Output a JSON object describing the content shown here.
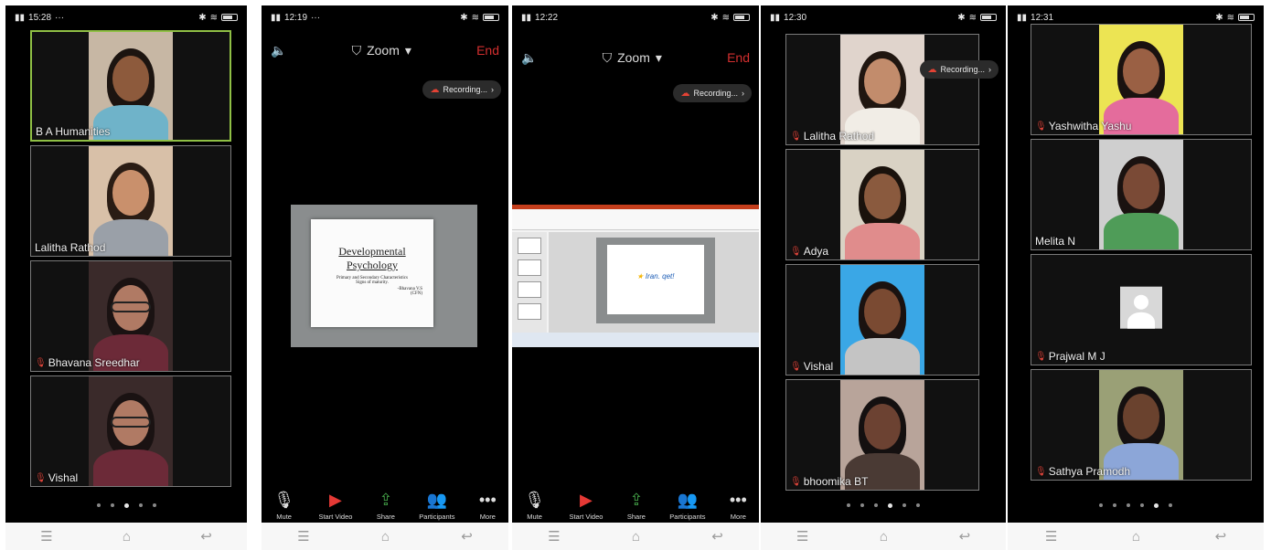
{
  "colors": {
    "active_border": "#8fbf45",
    "end_red": "#d32f2f",
    "mic_off": "#e0463c",
    "video_off": "#e53935",
    "share_green": "#43a047"
  },
  "screens": [
    {
      "status": {
        "time": "15:28",
        "extra": "···"
      },
      "tiles": [
        {
          "name": "B A Humanities",
          "muted": false,
          "bg": "#c7b7a4",
          "skin": "#8d5a3c",
          "hair": "#1c1410",
          "shirt": "#6fb3c9"
        },
        {
          "name": "Lalitha Rathod",
          "muted": false,
          "bg": "#d8c0a8",
          "skin": "#c9906c",
          "hair": "#2a1c14",
          "shirt": "#9aa0a8"
        },
        {
          "name": "Bhavana Sreedhar",
          "muted": true,
          "bg": "#3a2a2a",
          "skin": "#b07a64",
          "hair": "#1a1212",
          "shirt": "#6c2a38"
        },
        {
          "name": "Vishal",
          "muted": true,
          "bg": "#3a2a2a",
          "skin": "#b07a64",
          "hair": "#1a1212",
          "shirt": "#6c2a38"
        }
      ],
      "dots": 5,
      "active_dot": 2
    },
    {
      "status": {
        "time": "12:19",
        "extra": "···"
      },
      "top": {
        "title": "Zoom",
        "end": "End"
      },
      "recording": "Recording...",
      "slide": {
        "title_line1": "Developmental",
        "title_line2": "Psychology",
        "line1": "Primary and Secondary Characteristics",
        "line2": "Signs of maturity.",
        "author": "-Bhavana V.S",
        "author2": "(CFN)"
      },
      "toolbar": [
        "Mute",
        "Start Video",
        "Share",
        "Participants",
        "More"
      ]
    },
    {
      "status": {
        "time": "12:22",
        "extra": ""
      },
      "top": {
        "title": "Zoom",
        "end": "End"
      },
      "recording": "Recording...",
      "slide_caption": "Iran. qet!",
      "toolbar": [
        "Mute",
        "Start Video",
        "Share",
        "Participants",
        "More"
      ]
    },
    {
      "status": {
        "time": "12:30",
        "extra": ""
      },
      "recording": "Recording...",
      "tiles": [
        {
          "name": "Lalitha Rathod",
          "muted": true,
          "bg": "#e0d4cc",
          "skin": "#c28c6c",
          "hair": "#201610",
          "shirt": "#f1ede6"
        },
        {
          "name": "Adya",
          "muted": true,
          "bg": "#d9d2c4",
          "skin": "#8a5a3e",
          "hair": "#1a120c",
          "shirt": "#e08c8c"
        },
        {
          "name": "Vishal",
          "muted": true,
          "bg": "#3aa7e6",
          "skin": "#7a4a32",
          "hair": "#1a1210",
          "shirt": "#c4c4c4"
        },
        {
          "name": "bhoomika BT",
          "muted": true,
          "bg": "#b8a49a",
          "skin": "#6c4232",
          "hair": "#141010",
          "shirt": "#4a3a34"
        }
      ],
      "dots": 6,
      "active_dot": 3
    },
    {
      "status": {
        "time": "12:31",
        "extra": ""
      },
      "tiles": [
        {
          "name": "Yashwitha Yashu",
          "muted": true,
          "bg": "#ece453",
          "skin": "#9a6044",
          "hair": "#1a1210",
          "shirt": "#e46c9c"
        },
        {
          "name": "Melita N",
          "muted": false,
          "bg": "#cfcfcf",
          "skin": "#7a4a36",
          "hair": "#1a1210",
          "shirt": "#4f9c58"
        },
        {
          "name": "Prajwal M J",
          "muted": true,
          "avatar": true
        },
        {
          "name": "Sathya Pramodh",
          "muted": true,
          "bg": "#9aa076",
          "skin": "#6a422e",
          "hair": "#141010",
          "shirt": "#8ca6d8"
        }
      ],
      "dots": 6,
      "active_dot": 4
    }
  ],
  "icons": {
    "speaker": "speaker-icon",
    "shield": "shield-icon",
    "chevron": "chevron-down-icon",
    "cloud": "cloud-record-icon",
    "mic": "microphone-icon",
    "video": "video-off-icon",
    "share": "share-icon",
    "participants": "participants-icon",
    "more": "more-icon",
    "menu": "menu-icon",
    "home": "home-icon",
    "back": "back-icon"
  }
}
